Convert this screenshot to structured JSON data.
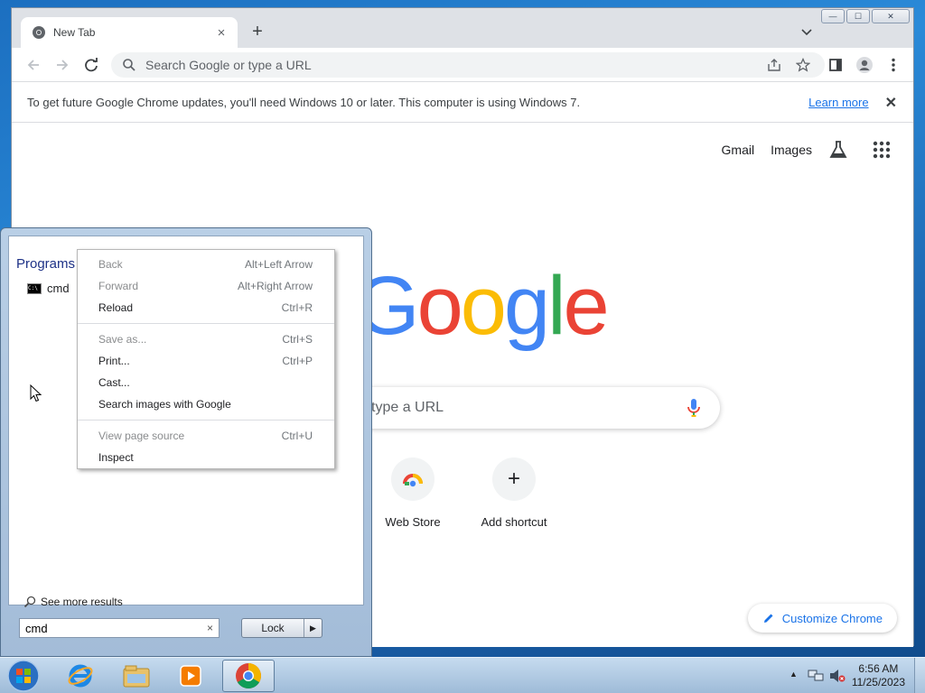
{
  "window": {
    "tab_title": "New Tab",
    "tab_close": "×",
    "new_tab": "+",
    "controls": {
      "minimize": "—",
      "maximize": "☐",
      "close": "✕"
    }
  },
  "toolbar": {
    "omnibox_placeholder": "Search Google or type a URL",
    "icons": [
      "back-icon",
      "forward-icon",
      "reload-icon",
      "share-icon",
      "star-icon",
      "side-panel-icon",
      "profile-icon",
      "menu-icon"
    ]
  },
  "infobar": {
    "message": "To get future Google Chrome updates, you'll need Windows 10 or later. This computer is using Windows 7.",
    "link": "Learn more",
    "close": "✕"
  },
  "ntp": {
    "links": {
      "gmail": "Gmail",
      "images": "Images"
    },
    "search_placeholder": "Search Google or type a URL",
    "visible_search_text": "type a URL",
    "shortcuts": [
      {
        "label": "Web Store",
        "icon": "webstore-icon"
      },
      {
        "label": "Add shortcut",
        "icon": "plus-icon",
        "glyph": "+"
      }
    ],
    "customize": "Customize Chrome",
    "colors": {
      "blue": "#4285f4",
      "red": "#ea4335",
      "yellow": "#fbbc05",
      "green": "#34a853",
      "accent": "#1a73e8"
    }
  },
  "start_menu": {
    "section": "Programs",
    "results": [
      {
        "label": "cmd",
        "icon": "cmd-icon",
        "icon_text": "C:\\"
      }
    ],
    "see_more": "See more results",
    "search_value": "cmd",
    "clear": "×",
    "lock": "Lock",
    "lock_arrow": "▶"
  },
  "context_menu": {
    "group1": [
      {
        "label": "Back",
        "shortcut": "Alt+Left Arrow",
        "disabled": true
      },
      {
        "label": "Forward",
        "shortcut": "Alt+Right Arrow",
        "disabled": true
      },
      {
        "label": "Reload",
        "shortcut": "Ctrl+R",
        "disabled": false
      }
    ],
    "group2": [
      {
        "label": "Save as...",
        "shortcut": "Ctrl+S",
        "disabled": true
      },
      {
        "label": "Print...",
        "shortcut": "Ctrl+P",
        "disabled": false
      },
      {
        "label": "Cast...",
        "shortcut": "",
        "disabled": false
      },
      {
        "label": "Search images with Google",
        "shortcut": "",
        "disabled": false
      }
    ],
    "group3": [
      {
        "label": "View page source",
        "shortcut": "Ctrl+U",
        "disabled": true
      },
      {
        "label": "Inspect",
        "shortcut": "",
        "disabled": false
      }
    ]
  },
  "taskbar": {
    "apps": [
      "ie-icon",
      "explorer-icon",
      "media-player-icon",
      "chrome-icon"
    ],
    "tray_arrow": "▲",
    "time": "6:56 AM",
    "date": "11/25/2023"
  }
}
